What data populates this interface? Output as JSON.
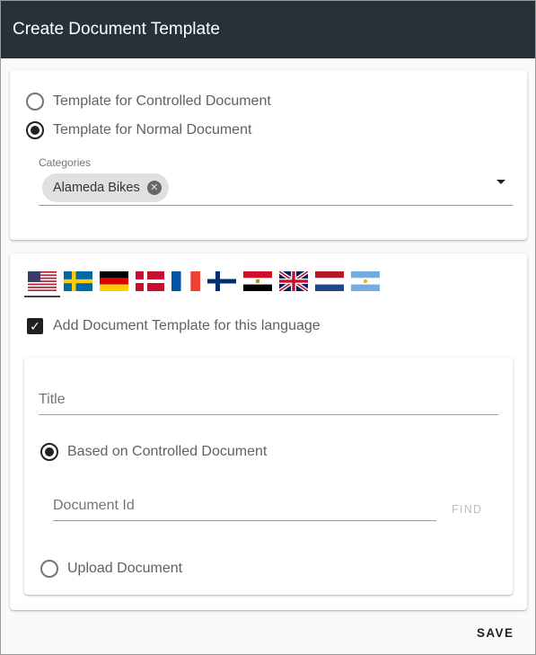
{
  "dialog": {
    "title": "Create Document Template"
  },
  "template_type": {
    "options": [
      {
        "label": "Template for Controlled Document",
        "selected": false
      },
      {
        "label": "Template for Normal Document",
        "selected": true
      }
    ]
  },
  "categories": {
    "label": "Categories",
    "chips": [
      "Alameda Bikes"
    ],
    "chip_remove_icon": "cancel-circle-icon",
    "dropdown_icon": "caret-down-icon"
  },
  "languages": {
    "flags": [
      "us-flag",
      "sweden-flag",
      "germany-flag",
      "denmark-flag",
      "france-flag",
      "finland-flag",
      "egypt-flag",
      "uk-flag",
      "netherlands-flag",
      "argentina-flag"
    ],
    "selected": "us-flag"
  },
  "language_toggle": {
    "label": "Add Document Template for this language",
    "checked": true
  },
  "form": {
    "title_placeholder": "Title",
    "source_options": [
      {
        "label": "Based on Controlled Document",
        "selected": true
      },
      {
        "label": "Upload Document",
        "selected": false
      }
    ],
    "document_id_placeholder": "Document Id",
    "find_label": "FIND"
  },
  "actions": {
    "save_label": "SAVE"
  },
  "colors": {
    "header_bg": "#263238",
    "chip_bg": "#e0e0e0"
  }
}
